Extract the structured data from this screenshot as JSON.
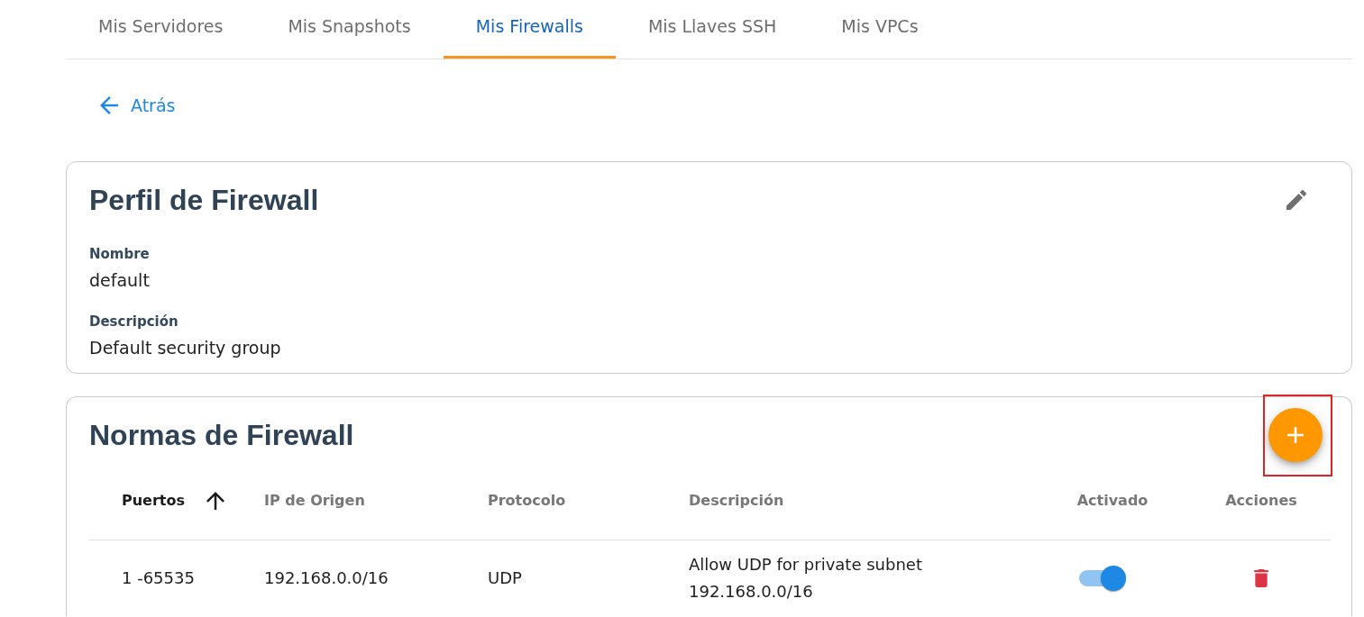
{
  "tabs": [
    {
      "label": "Mis Servidores",
      "selected": false
    },
    {
      "label": "Mis Snapshots",
      "selected": false
    },
    {
      "label": "Mis Firewalls",
      "selected": true
    },
    {
      "label": "Mis Llaves SSH",
      "selected": false
    },
    {
      "label": "Mis VPCs",
      "selected": false
    }
  ],
  "back_link": {
    "label": "Atrás"
  },
  "profile": {
    "title": "Perfil de Firewall",
    "fields": [
      {
        "label": "Nombre",
        "value": "default"
      },
      {
        "label": "Descripción",
        "value": "Default security group"
      }
    ]
  },
  "rules": {
    "title": "Normas de Firewall",
    "add_button": {
      "highlighted": true
    },
    "columns": [
      {
        "label": "Puertos",
        "sorted": true
      },
      {
        "label": "IP de Origen",
        "sorted": false
      },
      {
        "label": "Protocolo",
        "sorted": false
      },
      {
        "label": "Descripción",
        "sorted": false
      },
      {
        "label": "Activado",
        "sorted": false
      },
      {
        "label": "Acciones",
        "sorted": false
      }
    ],
    "rows": [
      {
        "ports": "1 -65535",
        "source_ip": "192.168.0.0/16",
        "protocol": "UDP",
        "description": "Allow UDP for private subnet 192.168.0.0/16",
        "enabled": true
      }
    ]
  }
}
